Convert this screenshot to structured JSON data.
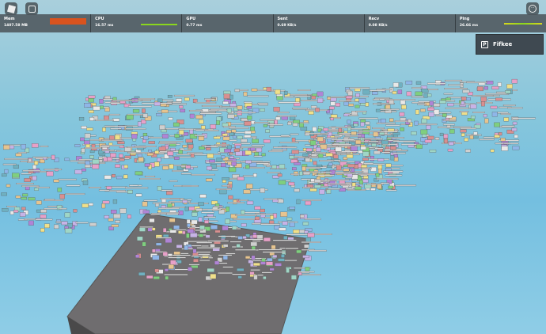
{
  "stats": [
    {
      "label": "Mem",
      "value": "1407.58 MB"
    },
    {
      "label": "CPU",
      "value": "16.57 ms"
    },
    {
      "label": "GPU",
      "value": "0.77 ms"
    },
    {
      "label": "Sent",
      "value": "0.69 KB/s"
    },
    {
      "label": "Recv",
      "value": "0.08 KB/s"
    },
    {
      "label": "Ping",
      "value": "26.66 ms"
    }
  ],
  "colors": {
    "mem_bar": "#d9531e",
    "graph_green": "#8ad61e",
    "graph_yellow": "#d6d61e"
  },
  "player": {
    "name": "Fifkee"
  },
  "icons": {
    "roblox": "roblox-logo-icon",
    "chat": "chat-icon",
    "menu": "more-options-icon",
    "player": "player-icon"
  }
}
